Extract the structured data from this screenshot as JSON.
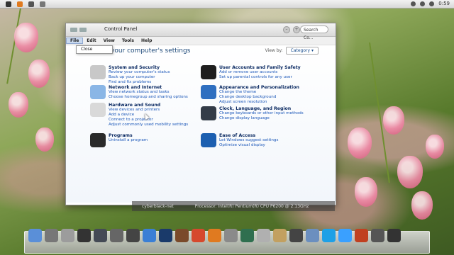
{
  "window": {
    "title": "Control Panel",
    "search_placeholder": "Search Co...",
    "menu": [
      "File",
      "Edit",
      "View",
      "Tools",
      "Help"
    ],
    "file_menu": [
      "Close"
    ],
    "heading": "Adjust your computer's settings",
    "view_by_label": "View by:",
    "view_by_value": "Category"
  },
  "categories_left": [
    {
      "title": "System and Security",
      "icon": "system-security-icon",
      "color": "#c8c8c8",
      "links": [
        "Review your computer's status",
        "Back up your computer",
        "Find and fix problems"
      ]
    },
    {
      "title": "Network and Internet",
      "icon": "network-icon",
      "color": "#8ab6e6",
      "links": [
        "View network status and tasks",
        "Choose homegroup and sharing options"
      ]
    },
    {
      "title": "Hardware and Sound",
      "icon": "hardware-sound-icon",
      "color": "#d9d9d9",
      "links": [
        "View devices and printers",
        "Add a device",
        "Connect to a projector",
        "Adjust commonly used mobility settings"
      ]
    },
    {
      "title": "Programs",
      "icon": "programs-icon",
      "color": "#2a2a2a",
      "links": [
        "Uninstall a program"
      ]
    }
  ],
  "categories_right": [
    {
      "title": "User Accounts and Family Safety",
      "icon": "user-accounts-icon",
      "color": "#1e1e1e",
      "links": [
        "Add or remove user accounts",
        "Set up parental controls for any user"
      ]
    },
    {
      "title": "Appearance and Personalization",
      "icon": "appearance-icon",
      "color": "#2f6fc0",
      "links": [
        "Change the theme",
        "Change desktop background",
        "Adjust screen resolution"
      ]
    },
    {
      "title": "Clock, Language, and Region",
      "icon": "clock-language-icon",
      "color": "#333c48",
      "links": [
        "Change keyboards or other input methods",
        "Change display language"
      ]
    },
    {
      "title": "Ease of Access",
      "icon": "ease-of-access-icon",
      "color": "#1c5fb0",
      "links": [
        "Let Windows suggest settings",
        "Optimize visual display"
      ]
    }
  ],
  "status": {
    "user": "cyberblack-net",
    "processor": "Processor: Intel(R) Pentium(R) CPU      P6200 @ 2.13GHz"
  },
  "topbar": {
    "time": "0:59"
  },
  "dock": [
    {
      "name": "finder-icon",
      "color": "#5a8fd8"
    },
    {
      "name": "computer-icon",
      "color": "#777777"
    },
    {
      "name": "printer-icon",
      "color": "#9c9c9c"
    },
    {
      "name": "terminal-icon",
      "color": "#333333"
    },
    {
      "name": "dashboard-icon",
      "color": "#444a55"
    },
    {
      "name": "microphone-icon",
      "color": "#666666"
    },
    {
      "name": "media-player-icon",
      "color": "#444444"
    },
    {
      "name": "music-icon",
      "color": "#3a7fd5"
    },
    {
      "name": "video-icon",
      "color": "#1a3a6a"
    },
    {
      "name": "film-icon",
      "color": "#7a4a2a"
    },
    {
      "name": "chrome-icon",
      "color": "#d6492d"
    },
    {
      "name": "firefox-icon",
      "color": "#e07a20"
    },
    {
      "name": "settings-icon",
      "color": "#8a8a8a"
    },
    {
      "name": "photos-icon",
      "color": "#2f6f4f"
    },
    {
      "name": "edit-icon",
      "color": "#b0b0b0"
    },
    {
      "name": "picture-icon",
      "color": "#c2a060"
    },
    {
      "name": "camera-icon",
      "color": "#444444"
    },
    {
      "name": "chat-icon",
      "color": "#6b8fbf"
    },
    {
      "name": "skype-icon",
      "color": "#1ea0e6"
    },
    {
      "name": "messenger-icon",
      "color": "#3aa0ff"
    },
    {
      "name": "compass-icon",
      "color": "#c04020"
    },
    {
      "name": "trash-icon",
      "color": "#555555"
    },
    {
      "name": "folder-icon",
      "color": "#333333"
    }
  ]
}
